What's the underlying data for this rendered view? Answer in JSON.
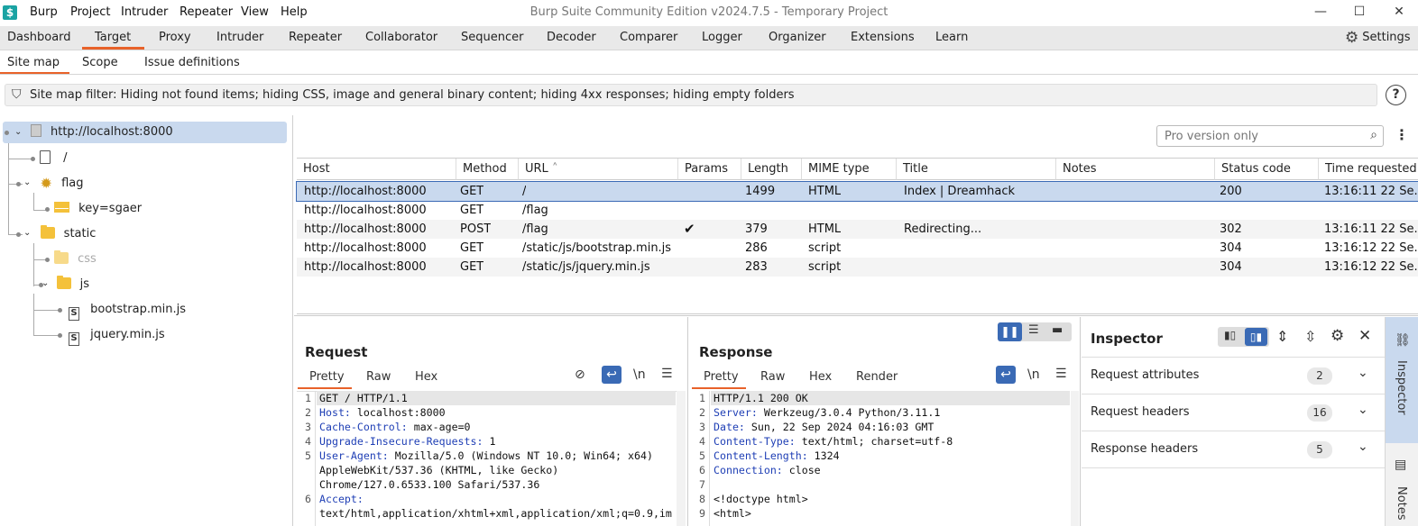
{
  "window": {
    "title": "Burp Suite Community Edition v2024.7.5 - Temporary Project",
    "logo": "$",
    "menu": [
      "Burp",
      "Project",
      "Intruder",
      "Repeater",
      "View",
      "Help"
    ],
    "minimize": "—",
    "maximize": "☐",
    "close": "✕"
  },
  "main_tabs": [
    "Dashboard",
    "Target",
    "Proxy",
    "Intruder",
    "Repeater",
    "Collaborator",
    "Sequencer",
    "Decoder",
    "Comparer",
    "Logger",
    "Organizer",
    "Extensions",
    "Learn"
  ],
  "active_main_tab": "Target",
  "settings_label": "Settings",
  "sub_tabs": [
    "Site map",
    "Scope",
    "Issue definitions"
  ],
  "filter_text": "Site map filter: Hiding not found items; hiding CSS, image and general binary content; hiding 4xx responses; hiding empty folders",
  "help_label": "?",
  "tree": {
    "root": "http://localhost:8000",
    "items": {
      "slash": "/",
      "flag": "flag",
      "flag_param": "key=sgaer",
      "static": "static",
      "css": "css",
      "js": "js",
      "bootstrap": "bootstrap.min.js",
      "jquery": "jquery.min.js"
    }
  },
  "search": {
    "placeholder": "Pro version only"
  },
  "table": {
    "headers": [
      "Host",
      "Method",
      "URL",
      "Params",
      "Length",
      "MIME type",
      "Title",
      "Notes",
      "Status code",
      "Time requested"
    ],
    "sort_indicator": "˄",
    "rows": [
      {
        "host": "http://localhost:8000",
        "method": "GET",
        "url": "/",
        "params": "",
        "length": "1499",
        "mime": "HTML",
        "title": "Index | Dreamhack",
        "notes": "",
        "status": "200",
        "time": "13:16:11 22 Se..."
      },
      {
        "host": "http://localhost:8000",
        "method": "GET",
        "url": "/flag",
        "params": "",
        "length": "",
        "mime": "",
        "title": "",
        "notes": "",
        "status": "",
        "time": ""
      },
      {
        "host": "http://localhost:8000",
        "method": "POST",
        "url": "/flag",
        "params": "✔",
        "length": "379",
        "mime": "HTML",
        "title": "Redirecting...",
        "notes": "",
        "status": "302",
        "time": "13:16:11 22 Se..."
      },
      {
        "host": "http://localhost:8000",
        "method": "GET",
        "url": "/static/js/bootstrap.min.js",
        "params": "",
        "length": "286",
        "mime": "script",
        "title": "",
        "notes": "",
        "status": "304",
        "time": "13:16:12 22 Se..."
      },
      {
        "host": "http://localhost:8000",
        "method": "GET",
        "url": "/static/js/jquery.min.js",
        "params": "",
        "length": "283",
        "mime": "script",
        "title": "",
        "notes": "",
        "status": "304",
        "time": "13:16:12 22 Se..."
      }
    ]
  },
  "request": {
    "title": "Request",
    "tabs": [
      "Pretty",
      "Raw",
      "Hex"
    ],
    "newline_tool": "\\n",
    "lines": [
      {
        "n": "1",
        "k": "",
        "v": "GET / HTTP/1.1"
      },
      {
        "n": "2",
        "k": "Host:",
        "v": " localhost:8000"
      },
      {
        "n": "3",
        "k": "Cache-Control:",
        "v": " max-age=0"
      },
      {
        "n": "4",
        "k": "Upgrade-Insecure-Requests:",
        "v": " 1"
      },
      {
        "n": "5",
        "k": "User-Agent:",
        "v": " Mozilla/5.0 (Windows NT 10.0; Win64; x64)"
      },
      {
        "n": "",
        "k": "",
        "v": "AppleWebKit/537.36 (KHTML, like Gecko)"
      },
      {
        "n": "",
        "k": "",
        "v": "Chrome/127.0.6533.100 Safari/537.36"
      },
      {
        "n": "6",
        "k": "Accept:",
        "v": ""
      },
      {
        "n": "",
        "k": "",
        "v": "text/html,application/xhtml+xml,application/xml;q=0.9,im"
      }
    ]
  },
  "response": {
    "title": "Response",
    "tabs": [
      "Pretty",
      "Raw",
      "Hex",
      "Render"
    ],
    "newline_tool": "\\n",
    "lines": [
      {
        "n": "1",
        "k": "",
        "v": "HTTP/1.1 200 OK"
      },
      {
        "n": "2",
        "k": "Server:",
        "v": " Werkzeug/3.0.4 Python/3.11.1"
      },
      {
        "n": "3",
        "k": "Date:",
        "v": " Sun, 22 Sep 2024 04:16:03 GMT"
      },
      {
        "n": "4",
        "k": "Content-Type:",
        "v": " text/html; charset=utf-8"
      },
      {
        "n": "5",
        "k": "Content-Length:",
        "v": " 1324"
      },
      {
        "n": "6",
        "k": "Connection:",
        "v": " close"
      },
      {
        "n": "7",
        "k": "",
        "v": ""
      },
      {
        "n": "8",
        "k": "",
        "v": "<!doctype html>"
      },
      {
        "n": "9",
        "k": "",
        "v": "<html>"
      }
    ]
  },
  "inspector": {
    "title": "Inspector",
    "sections": [
      {
        "label": "Request attributes",
        "count": "2"
      },
      {
        "label": "Request headers",
        "count": "16"
      },
      {
        "label": "Response headers",
        "count": "5"
      }
    ]
  },
  "sidebar": {
    "inspector_label": "Inspector",
    "notes_label": "Notes"
  },
  "colors": {
    "accent": "#e8622a",
    "selection": "#c9d9ee",
    "primary_button": "#3a6ab5",
    "header_key": "#1f3fb5"
  }
}
